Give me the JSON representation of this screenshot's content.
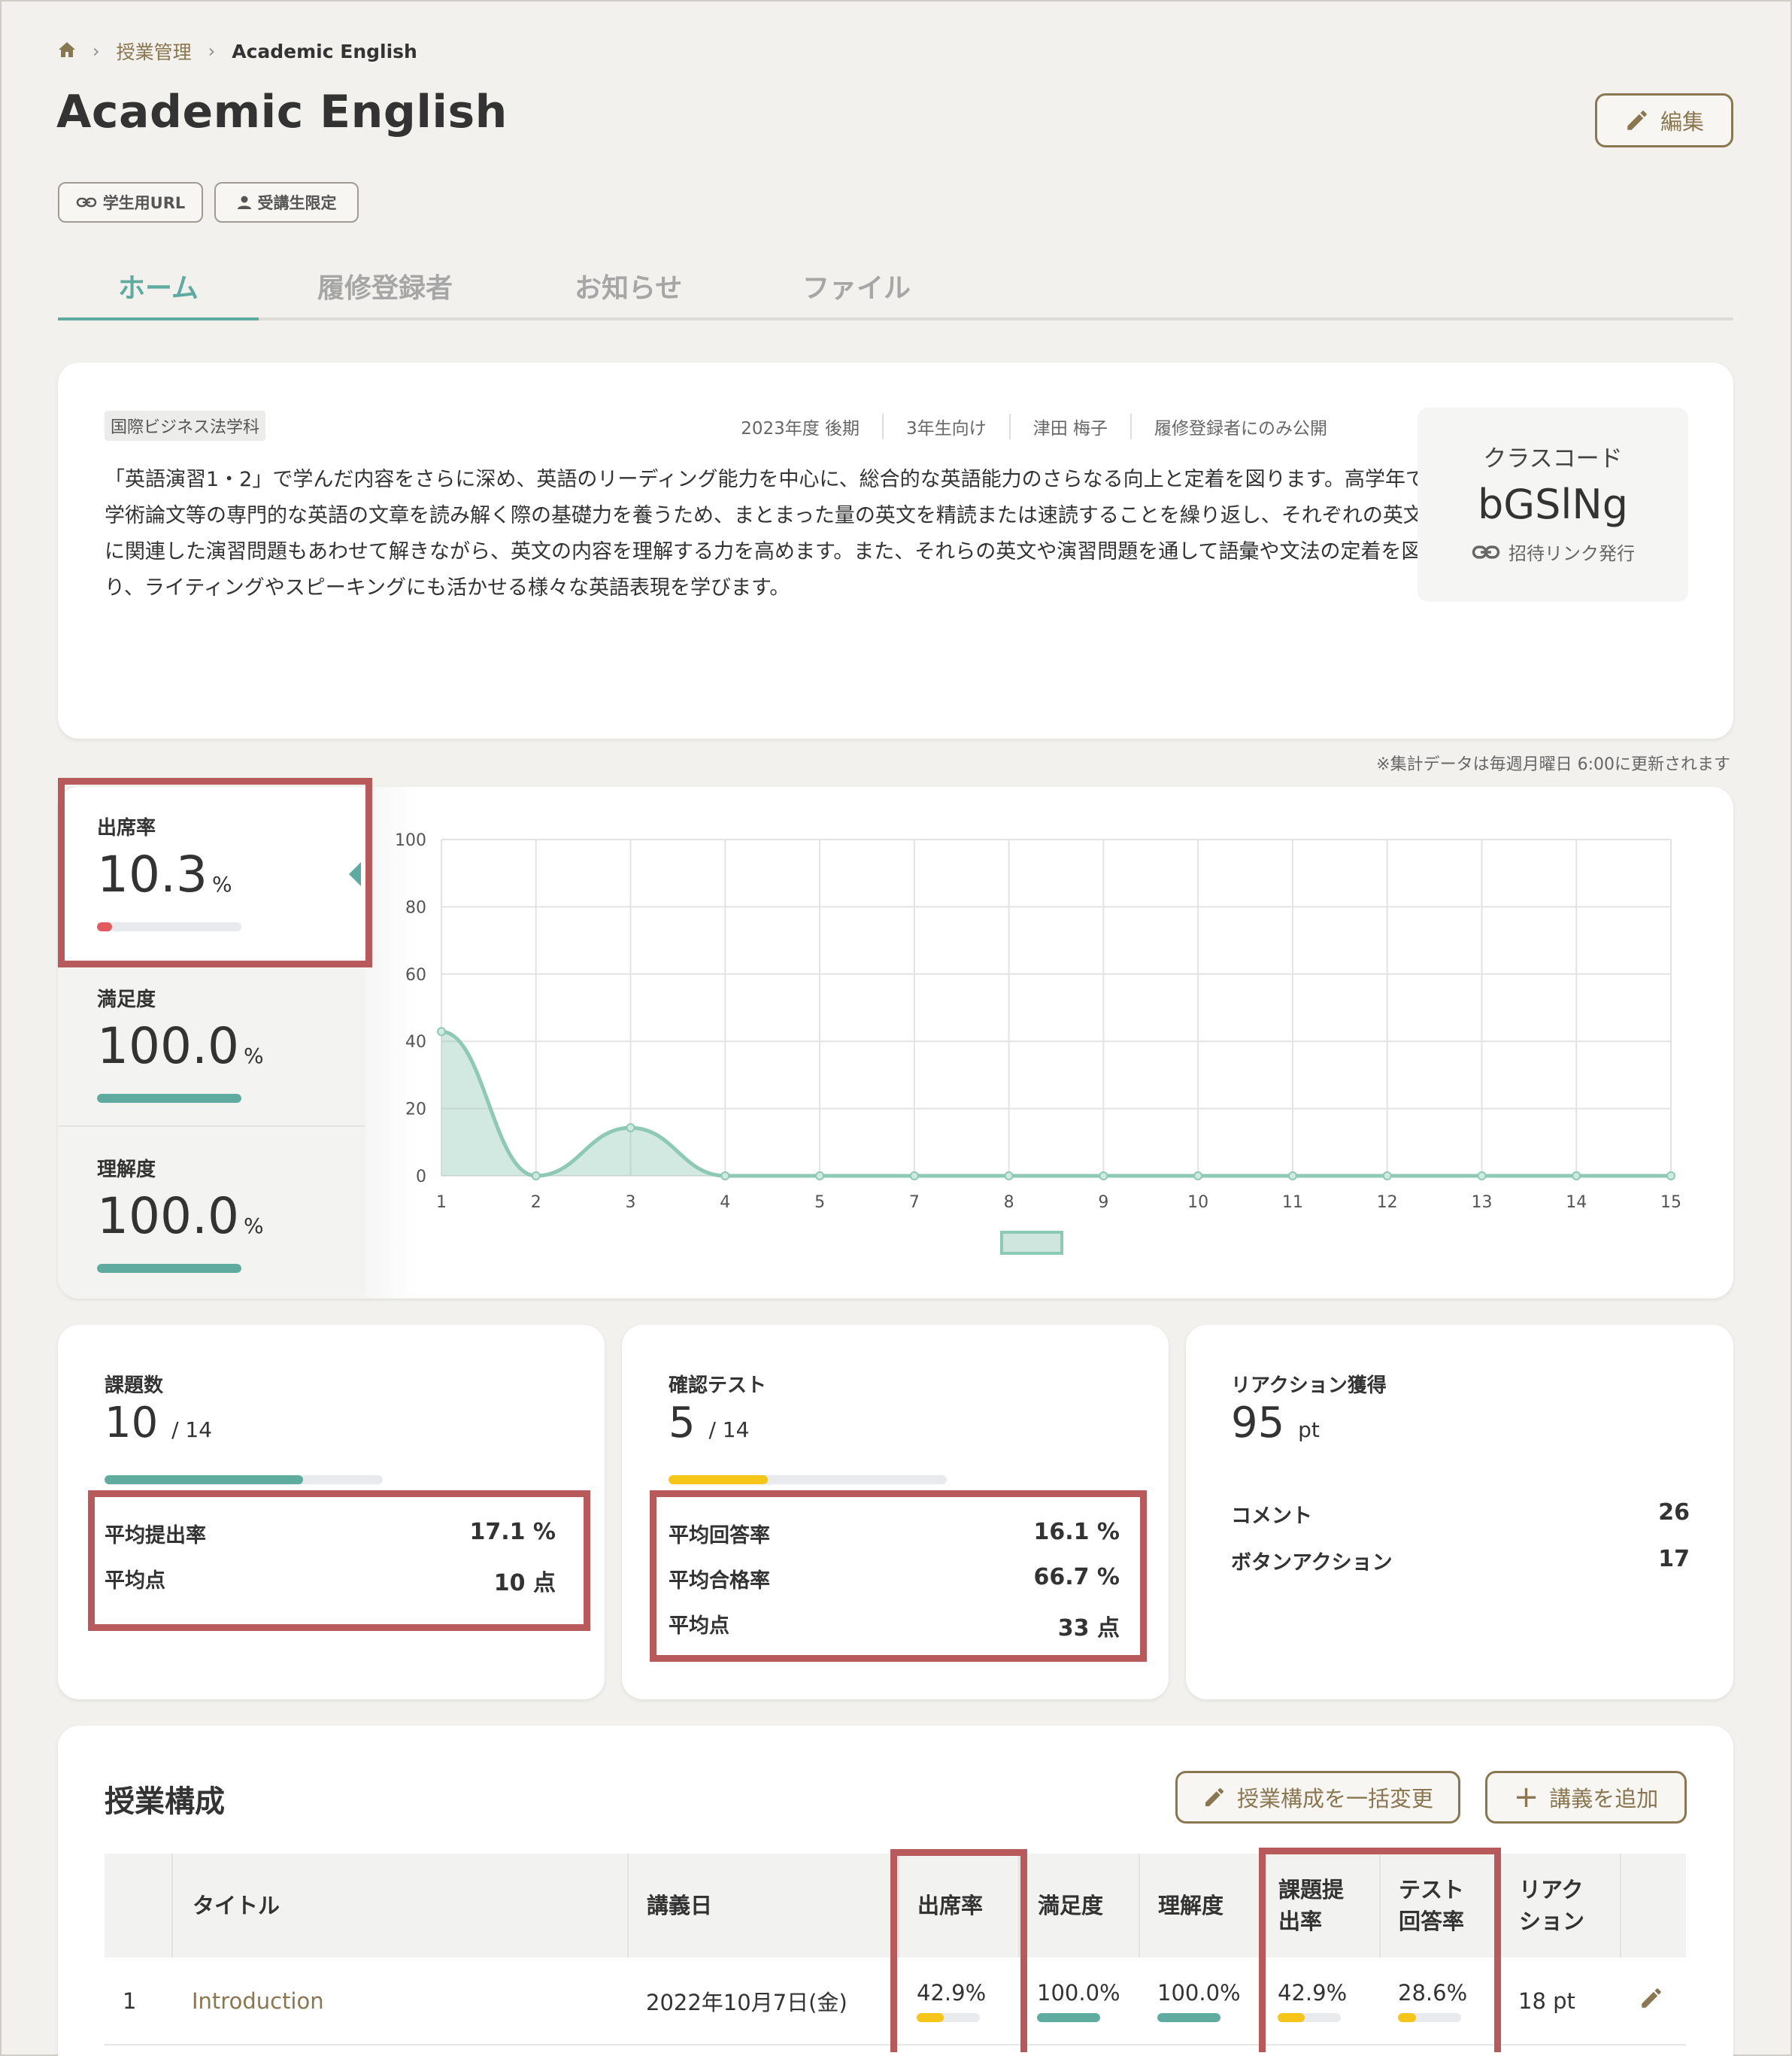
{
  "breadcrumb": {
    "home_icon": "home-icon",
    "parent": "授業管理",
    "current": "Academic English"
  },
  "page_title": "Academic English",
  "edit_button": "編集",
  "chips": {
    "student_url": "学生用URL",
    "students_only": "受講生限定"
  },
  "tabs": [
    "ホーム",
    "履修登録者",
    "お知らせ",
    "ファイル"
  ],
  "course": {
    "department": "国際ビジネス法学科",
    "meta": [
      "2023年度 後期",
      "3年生向け",
      "津田 梅子",
      "履修登録者にのみ公開"
    ],
    "description": "「英語演習1・2」で学んだ内容をさらに深め、英語のリーディング能力を中心に、総合的な英語能力のさらなる向上と定着を図ります。高学年で学術論文等の専門的な英語の文章を読み解く際の基礎力を養うため、まとまった量の英文を精読または速読することを繰り返し、それぞれの英文に関連した演習問題もあわせて解きながら、英文の内容を理解する力を高めます。また、それらの英文や演習問題を通して語彙や文法の定着を図り、ライティングやスピーキングにも活かせる様々な英語表現を学びます。",
    "class_code_label": "クラスコード",
    "class_code": "bGSlNg",
    "invite_link": "招待リンク発行"
  },
  "update_note": "※集計データは毎週月曜日 6:00に更新されます",
  "metrics": [
    {
      "label": "出席率",
      "value": "10.3",
      "unit": "%",
      "fraction": 0.103,
      "color": "#e05a5e"
    },
    {
      "label": "満足度",
      "value": "100.0",
      "unit": "%",
      "fraction": 1.0,
      "color": "#5faba0"
    },
    {
      "label": "理解度",
      "value": "100.0",
      "unit": "%",
      "fraction": 1.0,
      "color": "#5faba0"
    }
  ],
  "chart_data": {
    "type": "area",
    "x": [
      "1",
      "2",
      "3",
      "4",
      "5",
      "7",
      "8",
      "9",
      "10",
      "11",
      "12",
      "13",
      "14",
      "15"
    ],
    "values": [
      42.9,
      0,
      14.3,
      0,
      0,
      0,
      0,
      0,
      0,
      0,
      0,
      0,
      0,
      0
    ],
    "yticks": [
      "0",
      "20",
      "40",
      "60",
      "80",
      "100"
    ],
    "ylim": [
      0,
      100
    ],
    "grid": true,
    "color": "#8ec9b5"
  },
  "assignments": {
    "label": "課題数",
    "value": "10",
    "total": "/ 14",
    "fraction": 0.714,
    "rows": [
      {
        "label": "平均提出率",
        "value": "17.1 %"
      },
      {
        "label": "平均点",
        "value": "10 点"
      }
    ]
  },
  "tests": {
    "label": "確認テスト",
    "value": "5",
    "total": "/ 14",
    "fraction": 0.357,
    "rows": [
      {
        "label": "平均回答率",
        "value": "16.1 %"
      },
      {
        "label": "平均合格率",
        "value": "66.7 %"
      },
      {
        "label": "平均点",
        "value": "33 点"
      }
    ]
  },
  "reactions": {
    "label": "リアクション獲得",
    "value": "95",
    "unit": "pt",
    "rows": [
      {
        "label": "コメント",
        "value": "26"
      },
      {
        "label": "ボタンアクション",
        "value": "17"
      }
    ]
  },
  "structure": {
    "title": "授業構成",
    "bulk_edit": "授業構成を一括変更",
    "add_lecture": "講義を追加",
    "columns": [
      "タイトル",
      "講義日",
      "出席率",
      "満足度",
      "理解度",
      "課題提\n出率",
      "テスト\n回答率",
      "リアク\nション"
    ],
    "rows": [
      {
        "no": "1",
        "title": "Introduction",
        "date": "2022年10月7日(金)",
        "attendance": "42.9%",
        "satisfaction": "100.0%",
        "understanding": "100.0%",
        "submission": "42.9%",
        "test_answer": "28.6%",
        "reaction": "18 pt"
      }
    ]
  }
}
